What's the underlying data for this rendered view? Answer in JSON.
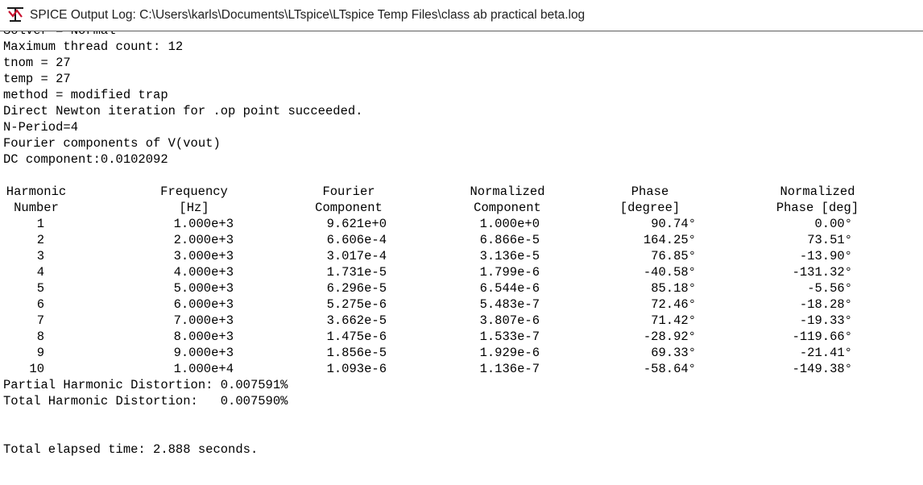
{
  "window": {
    "title": "SPICE Output Log: C:\\Users\\karls\\Documents\\LTspice\\LTspice Temp Files\\class ab practical beta.log",
    "icon": "ltspice-app-icon"
  },
  "log": {
    "clipped_line": "Solver = Normal",
    "header_lines": [
      "Maximum thread count: 12",
      "tnom = 27",
      "temp = 27",
      "method = modified trap",
      "Direct Newton iteration for .op point succeeded.",
      "N-Period=4",
      "Fourier components of V(vout)",
      "DC component:0.0102092"
    ],
    "table": {
      "header_row1": [
        "Harmonic",
        "Frequency",
        "Fourier",
        "Normalized",
        "Phase",
        "Normalized"
      ],
      "header_row2": [
        "Number",
        "[Hz]",
        "Component",
        "Component",
        "[degree]",
        "Phase [deg]"
      ],
      "rows": [
        [
          "1",
          "1.000e+3",
          "9.621e+0",
          "1.000e+0",
          "90.74°",
          "0.00°"
        ],
        [
          "2",
          "2.000e+3",
          "6.606e-4",
          "6.866e-5",
          "164.25°",
          "73.51°"
        ],
        [
          "3",
          "3.000e+3",
          "3.017e-4",
          "3.136e-5",
          "76.85°",
          "-13.90°"
        ],
        [
          "4",
          "4.000e+3",
          "1.731e-5",
          "1.799e-6",
          "-40.58°",
          "-131.32°"
        ],
        [
          "5",
          "5.000e+3",
          "6.296e-5",
          "6.544e-6",
          "85.18°",
          "-5.56°"
        ],
        [
          "6",
          "6.000e+3",
          "5.275e-6",
          "5.483e-7",
          "72.46°",
          "-18.28°"
        ],
        [
          "7",
          "7.000e+3",
          "3.662e-5",
          "3.807e-6",
          "71.42°",
          "-19.33°"
        ],
        [
          "8",
          "8.000e+3",
          "1.475e-6",
          "1.533e-7",
          "-28.92°",
          "-119.66°"
        ],
        [
          "9",
          "9.000e+3",
          "1.856e-5",
          "1.929e-6",
          "69.33°",
          "-21.41°"
        ],
        [
          "10",
          "1.000e+4",
          "1.093e-6",
          "1.136e-7",
          "-58.64°",
          "-149.38°"
        ]
      ]
    },
    "partial_hd": "Partial Harmonic Distortion: 0.007591%",
    "total_hd": "Total Harmonic Distortion:   0.007590%",
    "elapsed": "Total elapsed time: 2.888 seconds."
  }
}
